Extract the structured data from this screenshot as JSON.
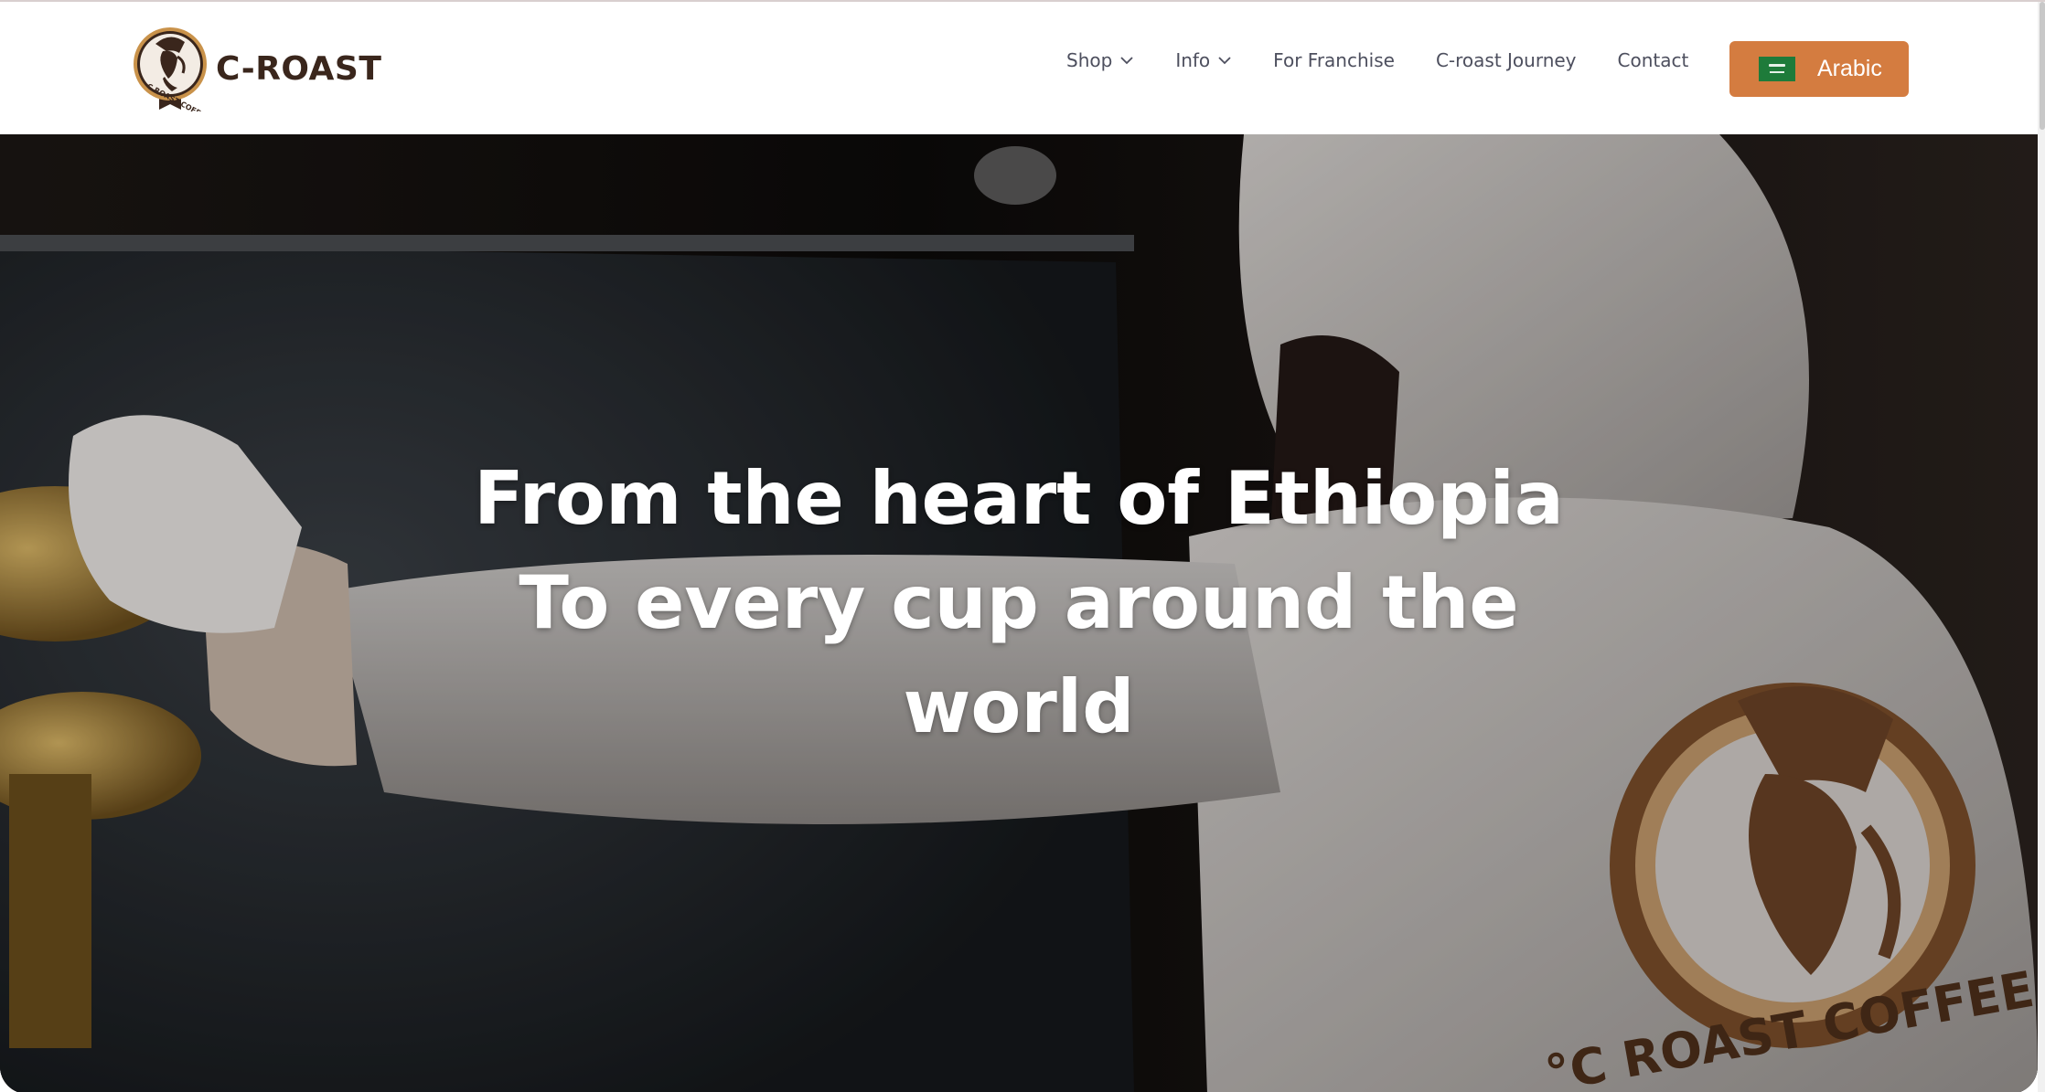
{
  "brand": {
    "name": "C-ROAST",
    "logo_ring_text": "C ROAST COFFEE"
  },
  "nav": {
    "items": [
      {
        "label": "Shop",
        "has_dropdown": true
      },
      {
        "label": "Info",
        "has_dropdown": true
      },
      {
        "label": "For Franchise",
        "has_dropdown": false
      },
      {
        "label": "C-roast Journey",
        "has_dropdown": false
      },
      {
        "label": "Contact",
        "has_dropdown": false
      }
    ]
  },
  "language_button": {
    "label": "Arabic",
    "flag_icon": "saudi-flag-icon"
  },
  "hero": {
    "title_lines": [
      "From the heart of Ethiopia",
      "To every cup around the",
      "world"
    ],
    "background_description_icon": "coffee-roaster-photo",
    "jacket_logo_text": "°C ROAST COFFEE"
  },
  "colors": {
    "accent": "#d47c40",
    "brand_dark": "#3a261c",
    "nav_text": "#4d4f5e",
    "logo_gold": "#c9924a"
  },
  "icons": {
    "dropdown": "chevron-down-icon",
    "flag": "saudi-flag-icon"
  }
}
